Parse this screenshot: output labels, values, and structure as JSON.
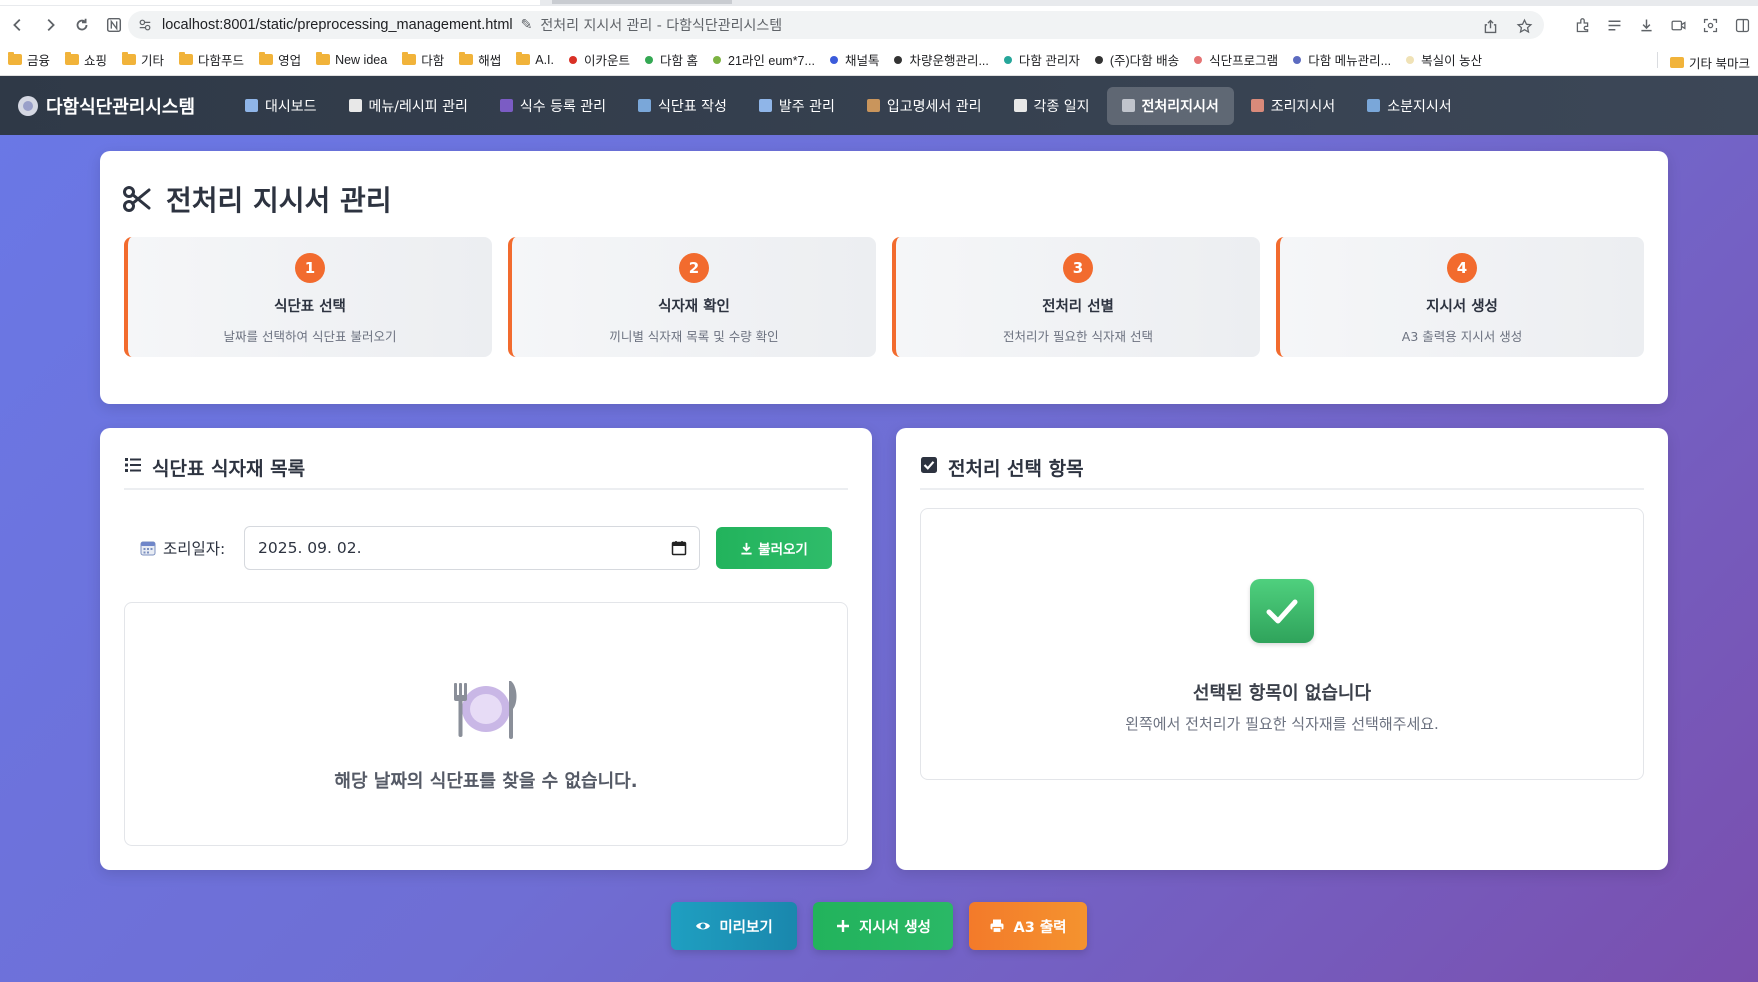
{
  "browser": {
    "url": "localhost:8001/static/preprocessing_management.html",
    "page_title": "전처리 지시서 관리 - 다함식단관리시스템",
    "bookmarks": [
      {
        "type": "folder",
        "label": "금융"
      },
      {
        "type": "folder",
        "label": "쇼핑"
      },
      {
        "type": "folder",
        "label": "기타"
      },
      {
        "type": "folder",
        "label": "다함푸드"
      },
      {
        "type": "folder",
        "label": "영업"
      },
      {
        "type": "folder",
        "label": "New idea"
      },
      {
        "type": "folder",
        "label": "다함"
      },
      {
        "type": "folder",
        "label": "해썹"
      },
      {
        "type": "folder",
        "label": "A.I."
      },
      {
        "type": "site",
        "label": "이카운트",
        "color": "#d93025"
      },
      {
        "type": "site",
        "label": "다함 홈",
        "color": "#34a853"
      },
      {
        "type": "site",
        "label": "21라인 eum*7...",
        "color": "#7cb342"
      },
      {
        "type": "site",
        "label": "채널톡",
        "color": "#3b5bdb"
      },
      {
        "type": "site",
        "label": "차량운행관리...",
        "color": "#333333"
      },
      {
        "type": "site",
        "label": "다함 관리자",
        "color": "#26a69a"
      },
      {
        "type": "site",
        "label": "(주)다함 배송",
        "color": "#333333"
      },
      {
        "type": "site",
        "label": "식단프로그램",
        "color": "#e57373"
      },
      {
        "type": "site",
        "label": "다함 메뉴관리...",
        "color": "#5c6bc0"
      },
      {
        "type": "site",
        "label": "복실이 농산",
        "color": "#f0e2b6"
      }
    ],
    "other_bookmarks": "기타 북마크"
  },
  "app": {
    "brand": "다함식단관리시스템",
    "nav": [
      {
        "label": "대시보드",
        "color": "#8fb5e8",
        "active": false
      },
      {
        "label": "메뉴/레시피 관리",
        "color": "#e8e8e8",
        "active": false
      },
      {
        "label": "식수 등록 관리",
        "color": "#7b5cc4",
        "active": false
      },
      {
        "label": "식단표 작성",
        "color": "#7aa7d9",
        "active": false
      },
      {
        "label": "발주 관리",
        "color": "#8fb5e8",
        "active": false
      },
      {
        "label": "입고명세서 관리",
        "color": "#c9955c",
        "active": false
      },
      {
        "label": "각종 일지",
        "color": "#e8e8e8",
        "active": false
      },
      {
        "label": "전처리지시서",
        "color": "#c0c4cc",
        "active": true
      },
      {
        "label": "조리지시서",
        "color": "#d98a7a",
        "active": false
      },
      {
        "label": "소분지시서",
        "color": "#7aa7d9",
        "active": false
      }
    ]
  },
  "header": {
    "title": "전처리 지시서 관리",
    "steps": [
      {
        "num": "1",
        "title": "식단표 선택",
        "desc": "날짜를 선택하여 식단표 불러오기"
      },
      {
        "num": "2",
        "title": "식자재 확인",
        "desc": "끼니별 식자재 목록 및 수량 확인"
      },
      {
        "num": "3",
        "title": "전처리 선별",
        "desc": "전처리가 필요한 식자재 선택"
      },
      {
        "num": "4",
        "title": "지시서 생성",
        "desc": "A3 출력용 지시서 생성"
      }
    ]
  },
  "left_panel": {
    "title": "식단표 식자재 목록",
    "date_label": "조리일자:",
    "date_value": "2025. 09. 02.",
    "load_button": "불러오기",
    "empty_message": "해당 날짜의 식단표를 찾을 수 없습니다."
  },
  "right_panel": {
    "title": "전처리 선택 항목",
    "empty_title": "선택된 항목이 없습니다",
    "empty_desc": "왼쪽에서 전처리가 필요한 식자재를 선택해주세요."
  },
  "actions": {
    "preview": "미리보기",
    "create": "지시서 생성",
    "print": "A3 출력"
  },
  "colors": {
    "accent_orange": "#f26b2e",
    "success_green": "#22b35c",
    "info_teal": "#1f9fc1",
    "navbar_dark": "#2f3947"
  }
}
